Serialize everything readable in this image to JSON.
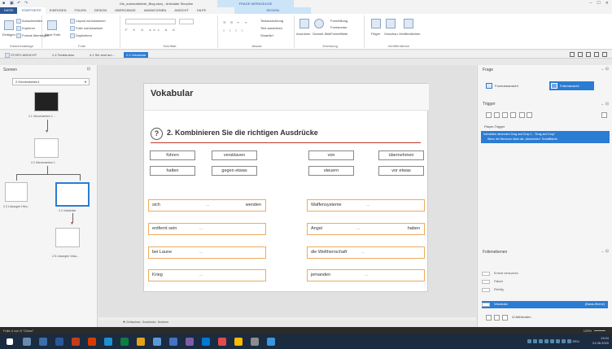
{
  "window": {
    "title": "Die_automatisierte_Blog.story - Articulate Storyline",
    "context_header": "FRAGE WERKZEUGE",
    "controls": [
      "–",
      "☐",
      "✕"
    ]
  },
  "ribbon_tabs": [
    "DATEI",
    "STARTSEITE",
    "EINFÜGEN",
    "FOLIEN",
    "DESIGN",
    "ÜBERGÄNGE",
    "ANIMATIONEN",
    "ANSICHT",
    "HILFE",
    "DESIGN"
  ],
  "ribbon": {
    "clipboard": {
      "label": "Zwischenablage",
      "paste": "Einfügen",
      "cut": "Ausschneiden",
      "copy": "Kopieren",
      "format": "Format übertragen"
    },
    "slide": {
      "label": "Folie",
      "new": "Neue Folie",
      "layout": "Layout zurücksetzen",
      "reset": "Folie zurücksetzen",
      "dup": "Duplizieren"
    },
    "font": {
      "label": "Schriftart",
      "font_value": "",
      "size_value": ""
    },
    "paragraph": {
      "label": "Absatz",
      "text_dir": "Textausrichtung",
      "align": "Text ausrichten",
      "smart": "SmartArt"
    },
    "drawing": {
      "label": "Zeichnung",
      "arrange": "Anordnen",
      "styles": "Schnell-Stile",
      "fill": "Formfüllung",
      "outline": "Formkontur",
      "effects": "Formeffekte"
    },
    "publish": {
      "label": "Veröffentlichen",
      "player": "Player",
      "preview": "Vorschau",
      "publish": "Veröffentlichen"
    }
  },
  "doc_tabs": {
    "story": "STORY-ANSICHT",
    "tabs": [
      "2.4 Textstruktur",
      "4.1 Sie sind am...",
      "2.4 Vokabular"
    ],
    "active": "2.4 Vokabular"
  },
  "scenes": {
    "title": "Szenen",
    "selected_scene": "2 Hörverstehen1",
    "thumbs": [
      {
        "label": "2.1 Hörverstehen 1..."
      },
      {
        "label": "2.2 Hörverstehen 1"
      },
      {
        "label": "2.3 Lösungen Hörv..."
      },
      {
        "label": "2.4 Vokabular"
      },
      {
        "label": "2.5 Lösungen Voka..."
      }
    ]
  },
  "slide": {
    "title": "Vokabular",
    "question_icon": "?",
    "question": "2. Kombinieren Sie die richtigen Ausdrücke",
    "words": [
      "führen",
      "versklaven",
      "von",
      "übernehmen",
      "halten",
      "gegen etwas",
      "steuern",
      "vor etwas"
    ],
    "drop_targets": [
      {
        "left": "sich",
        "dots": "...",
        "right": "wenden"
      },
      {
        "left": "Waffensysteme",
        "dots": "...",
        "right": ""
      },
      {
        "left": "entfernt sein",
        "dots": "...",
        "right": ""
      },
      {
        "left": "Angst",
        "dots": "...",
        "right": "haben"
      },
      {
        "left": "bei Laune",
        "dots": "...",
        "right": ""
      },
      {
        "left": "die Weltherrschaft",
        "dots": "...",
        "right": ""
      },
      {
        "left": "Krieg",
        "dots": "...",
        "right": ""
      },
      {
        "left": "jemanden",
        "dots": "...",
        "right": ""
      }
    ]
  },
  "notes_tabs": "Zeitachse, Zustände, Notizen",
  "right_panel": {
    "frage_title": "Frage",
    "formular_view": "Formularansicht",
    "folien_view": "Folienansicht",
    "trigger_title": "Trigger",
    "player_trigger": "Player-Trigger",
    "trigger_line1": "Interaktion absenden Drag and Drop 1 - \"Drag and Drop\"",
    "trigger_line2": "Wenn der Benutzer klickt die „Abschicken\" Schaltfläche",
    "layers_title": "Folienebenen",
    "layers": [
      "Erneut versuchen",
      "Falsch",
      "Richtig"
    ],
    "base_layer": "Vokabular",
    "base_layer_note": "(Basis-Ebene)",
    "dim_label": "Abblenden"
  },
  "status": {
    "left": "Folie 4 von 5   \"Clean\"",
    "zoom": "125%"
  },
  "tray": {
    "time": "13:04",
    "date": "21.08.2020",
    "lang": "DEU"
  },
  "colors": {
    "accent": "#2b7cd3",
    "file_tab": "#2b579a",
    "drop_border": "#f0a95e",
    "underline": "#c0392b",
    "taskbar": "#1b2b40"
  }
}
